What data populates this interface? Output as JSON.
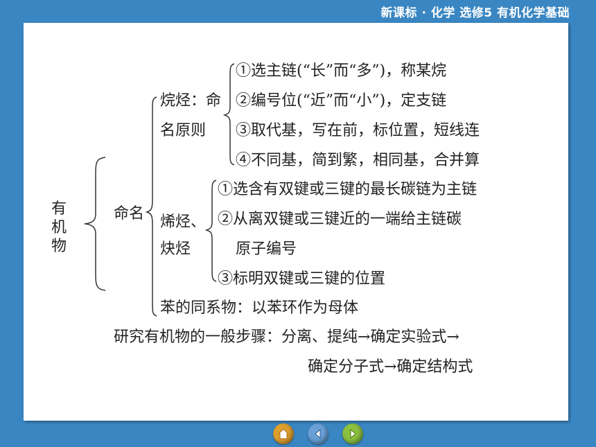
{
  "header": {
    "title": "新课标 · 化学  选修5  有机化学基础"
  },
  "content": {
    "root": [
      "有",
      "机",
      "物"
    ],
    "naming": "命名",
    "alkane_label": [
      "烷烃：命",
      "名原则"
    ],
    "alkane_rules": [
      "①选主链(“长”而“多”)，称某烷",
      "②编号位(“近”而“小”)，定支链",
      "③取代基，写在前，标位置，短线连",
      "④不同基，简到繁，相同基，合并算"
    ],
    "alkene_label": [
      "烯烃、",
      "炔烃"
    ],
    "alkene_rules": [
      "①选含有双键或三键的最长碳链为主链",
      "②从离双键或三键近的一端给主链碳",
      "原子编号",
      "③标明双键或三键的位置"
    ],
    "benzene": "苯的同系物：以苯环作为母体",
    "steps": [
      "研究有机物的一般步骤：分离、提纯→确定实验式→",
      "确定分子式→确定结构式"
    ]
  },
  "colors": {
    "background": "#3a86c2",
    "panel": "#ffffff",
    "home": "#e0a030",
    "back": "#6aa0d8",
    "next": "#8cc040"
  },
  "nav": {
    "icons": [
      "home-icon",
      "back-icon",
      "next-icon"
    ]
  }
}
